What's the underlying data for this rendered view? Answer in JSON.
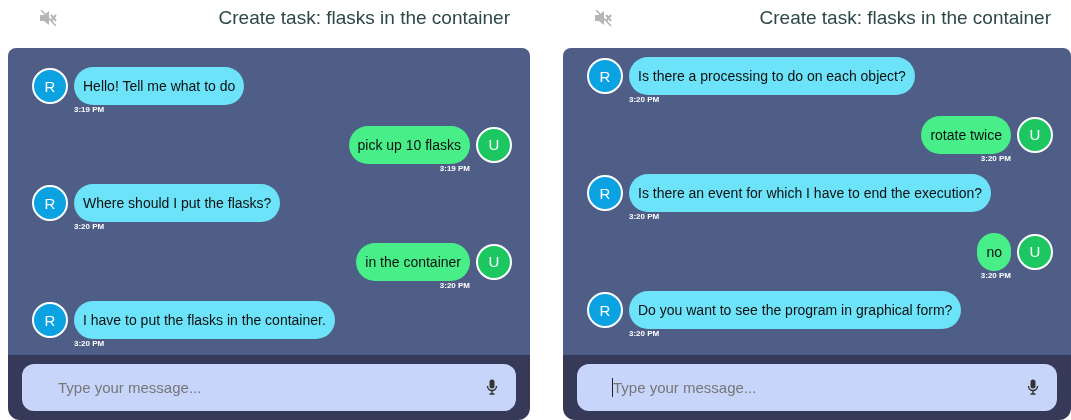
{
  "panels": [
    {
      "title": "Create task: flasks in the container",
      "messages": [
        {
          "kind": "bot",
          "avatar": "R",
          "text": "Hello! Tell me what to do",
          "time": "3:19 PM"
        },
        {
          "kind": "user",
          "avatar": "U",
          "text": "pick up 10 flasks",
          "time": "3:19 PM"
        },
        {
          "kind": "bot",
          "avatar": "R",
          "text": "Where should I put the flasks?",
          "time": "3:20 PM"
        },
        {
          "kind": "user",
          "avatar": "U",
          "text": "in the container",
          "time": "3:20 PM"
        },
        {
          "kind": "bot",
          "avatar": "R",
          "text": "I have to put the flasks in the container.",
          "time": "3:20 PM"
        }
      ],
      "input": {
        "placeholder": "Type your message...",
        "focused": false
      }
    },
    {
      "title": "Create task: flasks in the container",
      "messages": [
        {
          "kind": "bot",
          "avatar": "R",
          "text": "Is there a processing to do on each object?",
          "time": "3:20 PM"
        },
        {
          "kind": "user",
          "avatar": "U",
          "text": "rotate twice",
          "time": "3:20 PM"
        },
        {
          "kind": "bot",
          "avatar": "R",
          "text": "Is there an event for which I have to end the execution?",
          "time": "3:20 PM"
        },
        {
          "kind": "user",
          "avatar": "U",
          "text": "no",
          "time": "3:20 PM"
        },
        {
          "kind": "bot",
          "avatar": "R",
          "text": "Do you want to see the program in graphical form?",
          "time": "3:20 PM"
        }
      ],
      "input": {
        "placeholder": "Type your message...",
        "focused": true
      }
    }
  ]
}
